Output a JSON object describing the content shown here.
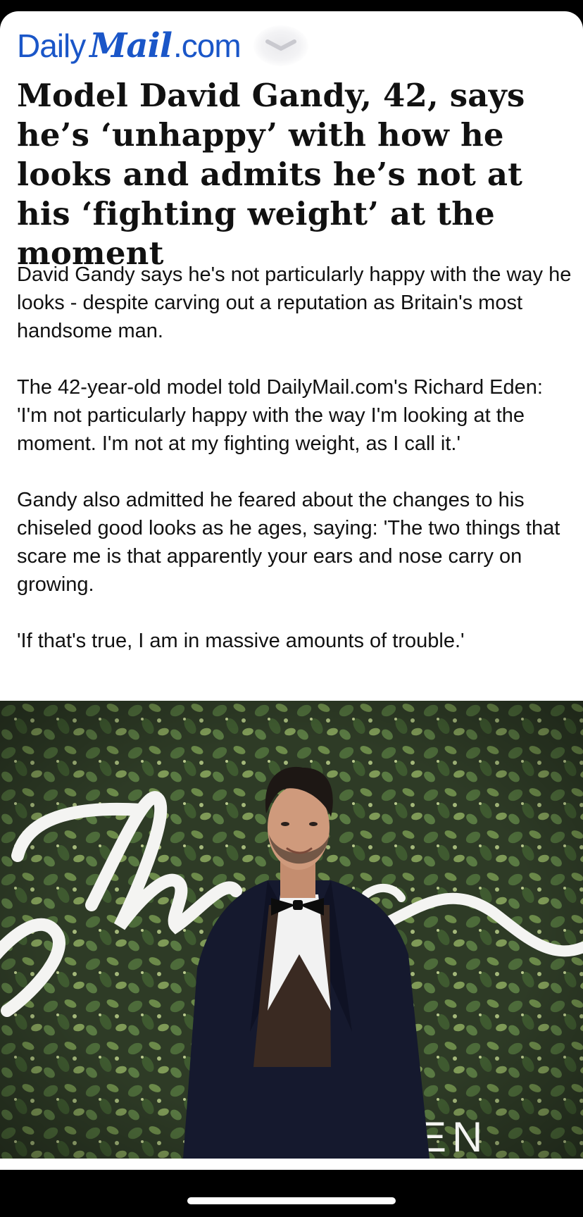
{
  "header": {
    "logo_daily": "Daily",
    "logo_mail": "Mail",
    "logo_dotcom": ".com",
    "menu_icon": "chevron-down-icon",
    "brand_color": "#1a56c8"
  },
  "article": {
    "headline": "Model David Gandy, 42, says he’s ‘unhappy’ with how he looks and admits he’s not at his ‘fighting weight’ at the moment",
    "paragraphs": [
      "David Gandy says he's not particularly happy with the way he looks - despite carving out a reputation as Britain's most handsome man.",
      "The 42-year-old model told DailyMail.com's Richard Eden: 'I'm not particularly happy with the way I'm looking at the moment. I'm not at my fighting weight, as I call it.'",
      "Gandy also admitted he feared about the changes to his chiseled good looks as he ages, saying: 'The two things that scare me is that apparently your ears and nose carry on growing.",
      "'If that's true, I am in massive amounts of trouble.'"
    ]
  },
  "photo": {
    "backdrop_text": "ESEN"
  }
}
